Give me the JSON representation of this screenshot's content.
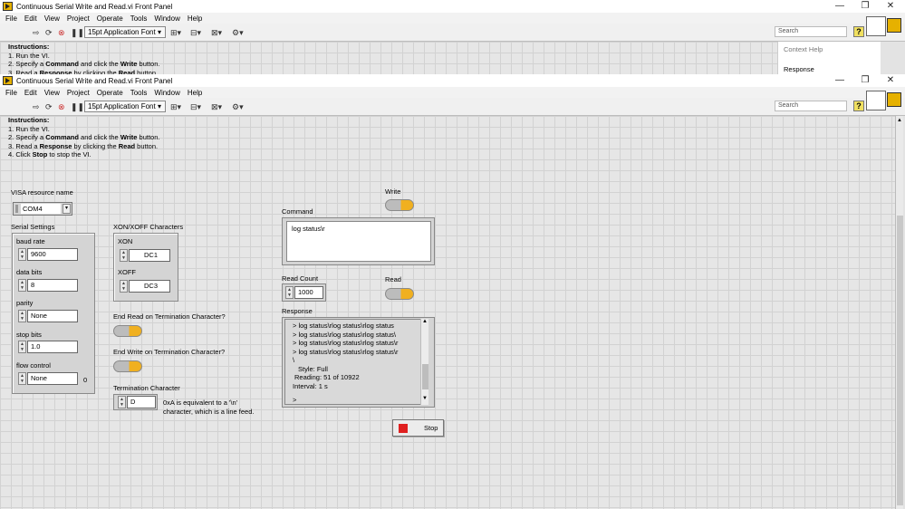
{
  "window_back": {
    "title": "Continuous Serial Write and Read.vi Front Panel",
    "menu": [
      "File",
      "Edit",
      "View",
      "Project",
      "Operate",
      "Tools",
      "Window",
      "Help"
    ],
    "font_selector": "15pt Application Font",
    "search_placeholder": "Search",
    "context_help": {
      "title": "Context Help",
      "item": "Response"
    },
    "instructions_title": "Instructions:",
    "instr_lines": [
      "1. Run the VI.",
      "2. Specify a ",
      "Command",
      " and click the ",
      "Write",
      " button.",
      "3. Read a ",
      "Response",
      " by clicking the ",
      "Read",
      " button."
    ]
  },
  "window_front": {
    "title": "Continuous Serial Write and Read.vi Front Panel",
    "menu": [
      "File",
      "Edit",
      "View",
      "Project",
      "Operate",
      "Tools",
      "Window",
      "Help"
    ],
    "font_selector": "15pt Application Font",
    "search_placeholder": "Search"
  },
  "instructions": {
    "title": "Instructions:",
    "line1": "1. Run the VI.",
    "line2a": "2. Specify a ",
    "line2b": "Command",
    "line2c": " and click the ",
    "line2d": "Write",
    "line2e": " button.",
    "line3a": "3. Read a ",
    "line3b": "Response",
    "line3c": " by clicking the ",
    "line3d": "Read",
    "line3e": " button.",
    "line4a": "4. Click ",
    "line4b": "Stop",
    "line4c": " to stop the VI."
  },
  "visa": {
    "label": "VISA resource name",
    "value": "COM4"
  },
  "serial": {
    "label": "Serial Settings",
    "baud_label": "baud rate",
    "baud": "9600",
    "databits_label": "data bits",
    "databits": "8",
    "parity_label": "parity",
    "parity": "None",
    "stopbits_label": "stop bits",
    "stopbits": "1.0",
    "flow_label": "flow control",
    "flow": "None",
    "flow_num": "0"
  },
  "xonxoff": {
    "label": "XON/XOFF Characters",
    "xon_label": "XON",
    "xon": "DC1",
    "xoff_label": "XOFF",
    "xoff": "DC3"
  },
  "end_read_label": "End Read on Termination Character?",
  "end_write_label": "End Write on Termination Character?",
  "termination": {
    "label": "Termination Character",
    "value": "D",
    "note1": "0xA is equivalent to a '\\n'",
    "note2": "character, which is a line feed."
  },
  "write": {
    "label": "Write"
  },
  "command": {
    "label": "Command",
    "value": "log status\\r"
  },
  "read_count": {
    "label": "Read Count",
    "value": "1000"
  },
  "read": {
    "label": "Read"
  },
  "response": {
    "label": "Response",
    "lines": [
      "> log status\\rlog status\\rlog status",
      "> log status\\rlog status\\rlog status\\",
      "> log status\\rlog status\\rlog status\\r",
      "> log status\\rlog status\\rlog status\\r"
    ],
    "blank": "\\",
    "style": "Style: Full",
    "reading": "Reading: 51 of 10922",
    "interval": "Interval: 1 s",
    "prompt": ">"
  },
  "stop": {
    "label": "Stop"
  },
  "colors": {
    "led_on": "#f0b020",
    "stop_red": "#e02020"
  }
}
